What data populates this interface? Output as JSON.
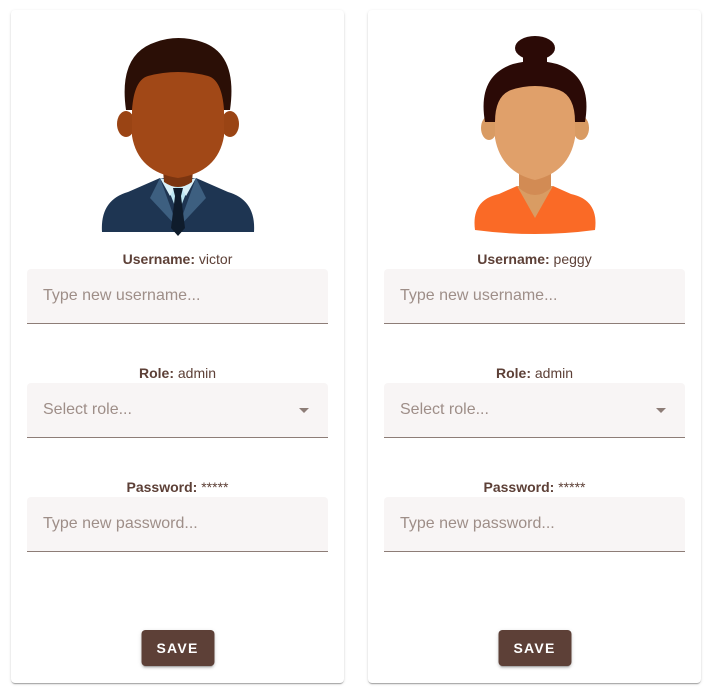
{
  "labels": {
    "username": "Username:",
    "role": "Role:",
    "password": "Password:"
  },
  "placeholders": {
    "username": "Type new username...",
    "role": "Select role...",
    "password": "Type new password..."
  },
  "save_label": "SAVE",
  "users": [
    {
      "avatar": "male-avatar-icon",
      "username": "victor",
      "role": "admin",
      "password": "*****"
    },
    {
      "avatar": "female-avatar-icon",
      "username": "peggy",
      "role": "admin",
      "password": "*****"
    }
  ],
  "colors": {
    "primary": "#5d4037",
    "field_bg": "#f8f5f5",
    "field_border": "#8d7d77"
  }
}
